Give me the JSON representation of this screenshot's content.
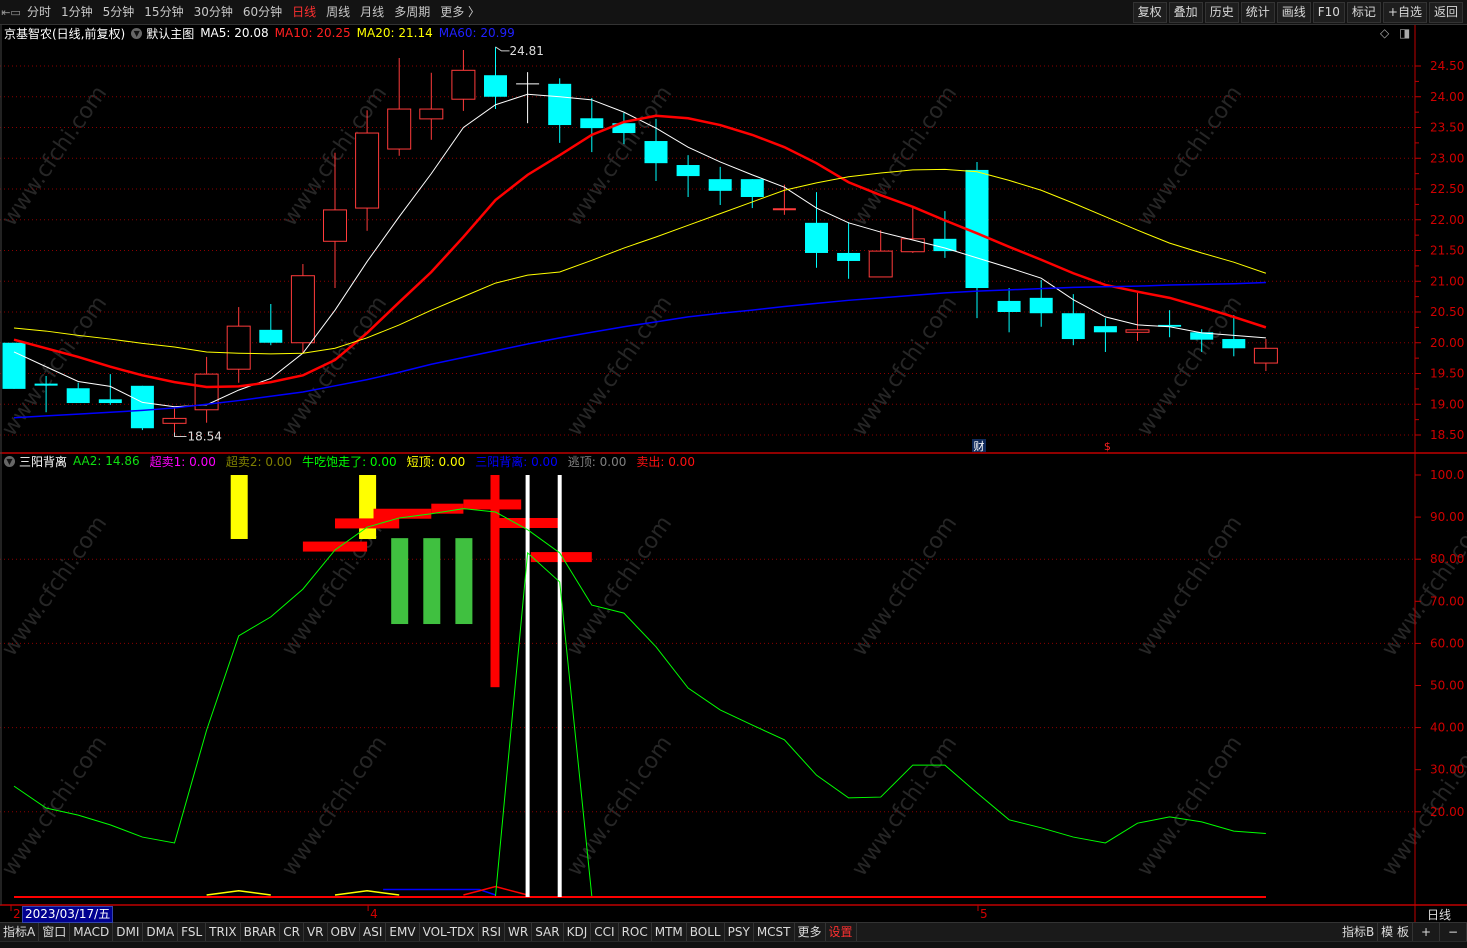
{
  "topbar": {
    "periods": [
      "分时",
      "1分钟",
      "5分钟",
      "15分钟",
      "30分钟",
      "60分钟",
      "日线",
      "周线",
      "月线",
      "多周期",
      "更多 〉"
    ],
    "active_period": "日线",
    "actions": [
      "复权",
      "叠加",
      "历史",
      "统计",
      "画线",
      "F10",
      "标记",
      "+自选",
      "返回"
    ]
  },
  "main_legend": {
    "title": "京基智农(日线,前复权)",
    "template": "默认主图",
    "ma5": "MA5: 20.08",
    "ma10": "MA10: 20.25",
    "ma20": "MA20: 21.14",
    "ma60": "MA60: 20.99"
  },
  "colors": {
    "up": "#ff3b3b",
    "down": "#00ffff",
    "ma5": "#ffffff",
    "ma10": "#ff0000",
    "ma20": "#ffff00",
    "ma60": "#0000ff",
    "grid": "#8b0000",
    "axis": "#c00000"
  },
  "chart_data": [
    {
      "type": "candlestick",
      "title": "京基智农 日线",
      "yaxis_ticks": [
        "24.50",
        "24.00",
        "23.50",
        "23.00",
        "22.50",
        "22.00",
        "21.50",
        "21.00",
        "20.50",
        "20.00",
        "19.50",
        "19.00",
        "18.50"
      ],
      "ylim": [
        18.5,
        24.5
      ],
      "ohlc": [
        [
          20.0,
          20.0,
          19.25,
          19.25
        ],
        [
          19.32,
          19.46,
          18.87,
          19.3
        ],
        [
          19.26,
          19.35,
          19.02,
          19.02
        ],
        [
          19.08,
          19.49,
          18.99,
          19.02
        ],
        [
          19.3,
          19.3,
          18.58,
          18.61
        ],
        [
          18.69,
          18.94,
          18.54,
          18.77
        ],
        [
          18.91,
          19.77,
          18.7,
          19.49
        ],
        [
          19.57,
          20.58,
          19.35,
          20.27
        ],
        [
          20.21,
          20.63,
          19.96,
          20.0
        ],
        [
          20.0,
          21.28,
          19.83,
          21.09
        ],
        [
          21.65,
          23.09,
          20.89,
          22.16
        ],
        [
          22.19,
          23.78,
          21.82,
          23.41
        ],
        [
          23.15,
          24.63,
          23.04,
          23.8
        ],
        [
          23.64,
          24.39,
          23.3,
          23.8
        ],
        [
          23.96,
          24.76,
          23.77,
          24.43
        ],
        [
          24.35,
          24.81,
          23.8,
          24.0
        ],
        [
          24.21,
          24.4,
          23.57,
          24.21
        ],
        [
          24.21,
          24.3,
          23.25,
          23.54
        ],
        [
          23.65,
          23.98,
          23.1,
          23.49
        ],
        [
          23.57,
          23.74,
          23.23,
          23.41
        ],
        [
          23.28,
          23.64,
          22.63,
          22.92
        ],
        [
          22.89,
          23.05,
          22.37,
          22.71
        ],
        [
          22.66,
          22.86,
          22.24,
          22.47
        ],
        [
          22.66,
          22.66,
          22.19,
          22.37
        ],
        [
          22.15,
          22.57,
          22.08,
          22.17
        ],
        [
          21.95,
          22.45,
          21.22,
          21.46
        ],
        [
          21.46,
          21.96,
          21.04,
          21.33
        ],
        [
          21.07,
          21.83,
          21.07,
          21.49
        ],
        [
          21.48,
          22.19,
          21.46,
          21.69
        ],
        [
          21.69,
          22.14,
          21.38,
          21.49
        ],
        [
          22.81,
          22.94,
          20.4,
          20.89
        ],
        [
          20.68,
          20.89,
          20.17,
          20.5
        ],
        [
          20.73,
          21.02,
          20.26,
          20.48
        ],
        [
          20.48,
          20.79,
          19.96,
          20.06
        ],
        [
          20.27,
          20.4,
          19.85,
          20.17
        ],
        [
          20.17,
          20.81,
          20.03,
          20.21
        ],
        [
          20.29,
          20.53,
          20.09,
          20.26
        ],
        [
          20.17,
          20.22,
          19.85,
          20.05
        ],
        [
          20.06,
          20.45,
          19.78,
          19.91
        ],
        [
          19.67,
          20.06,
          19.54,
          19.91
        ]
      ],
      "series": [
        {
          "name": "MA5",
          "values": [
            19.85,
            19.61,
            19.37,
            19.29,
            19.03,
            18.96,
            18.99,
            19.23,
            19.42,
            19.83,
            20.53,
            21.32,
            22.05,
            22.75,
            23.5,
            23.87,
            24.04,
            24.0,
            23.95,
            23.75,
            23.49,
            23.18,
            22.94,
            22.73,
            22.53,
            22.19,
            21.95,
            21.8,
            21.67,
            21.54,
            21.38,
            21.22,
            21.05,
            20.7,
            20.42,
            20.29,
            20.26,
            20.16,
            20.12,
            20.08
          ]
        },
        {
          "name": "MA10",
          "values": [
            20.05,
            19.91,
            19.77,
            19.61,
            19.47,
            19.36,
            19.28,
            19.29,
            19.36,
            19.47,
            19.72,
            20.16,
            20.66,
            21.15,
            21.72,
            22.32,
            22.73,
            23.05,
            23.38,
            23.59,
            23.69,
            23.65,
            23.54,
            23.38,
            23.18,
            22.92,
            22.61,
            22.4,
            22.21,
            21.99,
            21.78,
            21.56,
            21.35,
            21.13,
            20.94,
            20.83,
            20.73,
            20.58,
            20.42,
            20.25
          ]
        },
        {
          "name": "MA20",
          "values": [
            20.24,
            20.19,
            20.12,
            20.06,
            19.99,
            19.93,
            19.85,
            19.83,
            19.82,
            19.83,
            19.91,
            20.08,
            20.29,
            20.53,
            20.75,
            20.97,
            21.1,
            21.15,
            21.34,
            21.54,
            21.72,
            21.91,
            22.1,
            22.29,
            22.48,
            22.6,
            22.7,
            22.76,
            22.81,
            22.82,
            22.78,
            22.64,
            22.48,
            22.27,
            22.05,
            21.83,
            21.62,
            21.46,
            21.31,
            21.13
          ]
        },
        {
          "name": "MA60",
          "values": [
            18.78,
            18.81,
            18.84,
            18.87,
            18.9,
            18.94,
            19.0,
            19.06,
            19.13,
            19.2,
            19.3,
            19.4,
            19.52,
            19.65,
            19.76,
            19.87,
            19.98,
            20.08,
            20.17,
            20.26,
            20.34,
            20.42,
            20.48,
            20.53,
            20.59,
            20.64,
            20.69,
            20.73,
            20.77,
            20.81,
            20.84,
            20.86,
            20.88,
            20.9,
            20.91,
            20.92,
            20.94,
            20.95,
            20.96,
            20.98
          ]
        }
      ],
      "annotations": {
        "high_label": "24.81",
        "high_index": 15,
        "low_label": "18.54",
        "low_index": 5,
        "events": [
          {
            "label": "财",
            "index": 30
          },
          {
            "label": "$",
            "index": 34
          }
        ]
      }
    },
    {
      "type": "indicator",
      "title": "三阳背离",
      "ylim": [
        0,
        100
      ],
      "yaxis_ticks": [
        "100.0",
        "90.00",
        "80.00",
        "70.00",
        "60.00",
        "50.00",
        "40.00",
        "30.00",
        "20.00"
      ],
      "grid_values": [
        80,
        60,
        40,
        20
      ],
      "aa2": [
        26.1,
        20.9,
        19.2,
        16.9,
        14.0,
        12.6,
        39.4,
        61.8,
        66.3,
        72.9,
        82.2,
        87.6,
        89.8,
        90.8,
        92.0,
        91.2,
        87.0,
        81.5,
        69.1,
        67.2,
        59.2,
        49.4,
        44.2,
        40.6,
        37.1,
        28.7,
        23.3,
        23.5,
        31.1,
        31.1,
        24.5,
        18.1,
        16.2,
        14.0,
        12.6,
        17.3,
        18.8,
        17.6,
        15.4,
        14.86
      ],
      "spike": [
        [
          15,
          0
        ],
        [
          16,
          81.5
        ],
        [
          17,
          74.6
        ],
        [
          18,
          0
        ]
      ],
      "yellow_bars": [
        {
          "index": 7,
          "from": 84.8,
          "to": 100
        },
        {
          "index": 11,
          "from": 84.8,
          "to": 100
        }
      ],
      "green_bars": [
        {
          "index": 12,
          "from": 64.6,
          "to": 85
        },
        {
          "index": 13,
          "from": 64.6,
          "to": 85
        },
        {
          "index": 14,
          "from": 64.6,
          "to": 85
        }
      ],
      "red_vbar": {
        "index": 15,
        "from": 49.6,
        "to": 100
      },
      "white_lines": [
        16,
        17
      ],
      "red_blocks": [
        {
          "from": 9,
          "to": 11,
          "value": 83
        },
        {
          "from": 10,
          "to": 12,
          "value": 88.5
        },
        {
          "from": 11.2,
          "to": 13,
          "value": 90.8
        },
        {
          "from": 13,
          "to": 14,
          "value": 92
        },
        {
          "from": 14,
          "to": 15.8,
          "value": 93
        },
        {
          "from": 15,
          "to": 17,
          "value": 88.6
        },
        {
          "from": 16.1,
          "to": 18,
          "value": 80.5
        }
      ],
      "minor_lines": [
        {
          "color": "#ffff00",
          "points": [
            [
              6,
              0
            ],
            [
              7,
              1
            ],
            [
              8,
              0
            ]
          ]
        },
        {
          "color": "#ffff00",
          "points": [
            [
              10,
              0
            ],
            [
              11,
              1
            ],
            [
              12,
              0
            ]
          ]
        },
        {
          "color": "#0000ff",
          "points": [
            [
              11.5,
              1.3
            ],
            [
              14.5,
              1.3
            ],
            [
              15,
              0
            ]
          ]
        },
        {
          "color": "#ff0000",
          "points": [
            [
              14,
              0
            ],
            [
              15,
              2
            ],
            [
              16,
              0
            ]
          ]
        }
      ]
    }
  ],
  "indicator_legend": {
    "name": "三阳背离",
    "items": [
      {
        "text": "AA2: 14.86",
        "color": "#10e010"
      },
      {
        "text": "超卖1: 0.00",
        "color": "#ff00ff"
      },
      {
        "text": "超卖2: 0.00",
        "color": "#808000"
      },
      {
        "text": "牛吃饱走了: 0.00",
        "color": "#00ff00"
      },
      {
        "text": "短顶: 0.00",
        "color": "#ffff00"
      },
      {
        "text": "三阳背离: 0.00",
        "color": "#0000ff"
      },
      {
        "text": "逃顶: 0.00",
        "color": "#808080"
      },
      {
        "text": "卖出: 0.00",
        "color": "#ff1010"
      }
    ]
  },
  "date_axis": {
    "cursor_date": "2023/03/17/五",
    "month_labels": [
      {
        "label": "2",
        "index": 0
      },
      {
        "label": "4",
        "index": 11
      },
      {
        "label": "5",
        "index": 30
      }
    ],
    "period_label": "日线"
  },
  "bottombar": {
    "tabs": [
      "指标A",
      "窗口",
      "MACD",
      "DMI",
      "DMA",
      "FSL",
      "TRIX",
      "BRAR",
      "CR",
      "VR",
      "OBV",
      "ASI",
      "EMV",
      "VOL-TDX",
      "RSI",
      "WR",
      "SAR",
      "KDJ",
      "CCI",
      "ROC",
      "MTM",
      "BOLL",
      "PSY",
      "MCST",
      "更多",
      "设置"
    ],
    "right": [
      "指标B",
      "模 板",
      "+",
      "−"
    ]
  },
  "watermark": "www.cfchi.com"
}
